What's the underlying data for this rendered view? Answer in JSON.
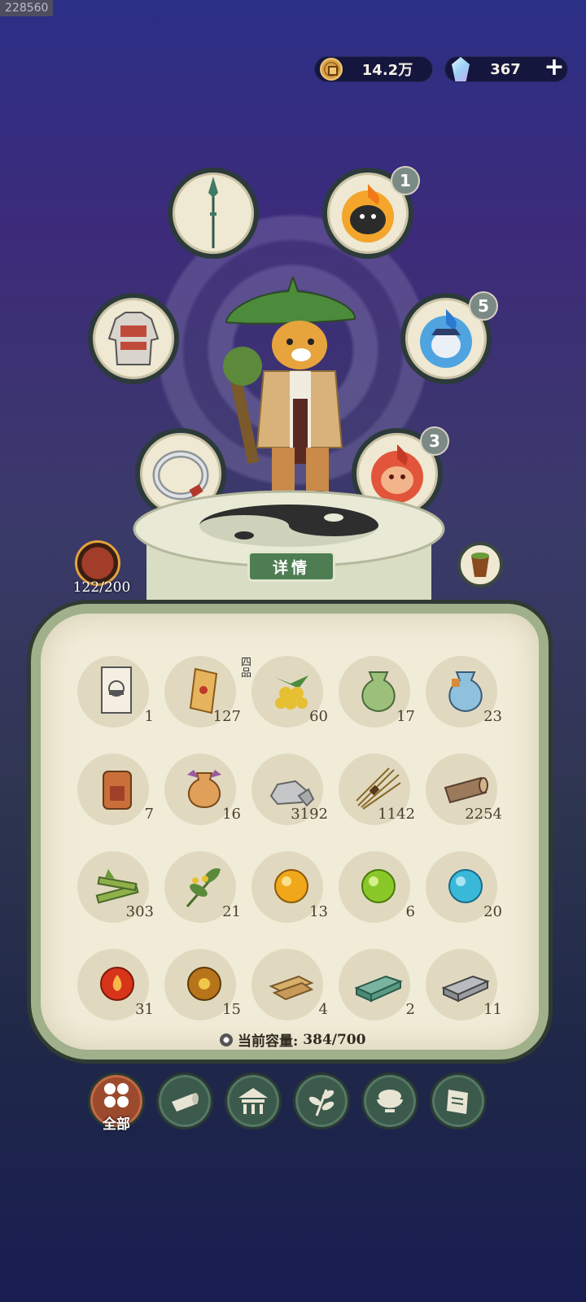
{
  "header": {
    "id_overlay": "228560",
    "coins": "14.2万",
    "gems": "367",
    "add_label": "+"
  },
  "equipment": {
    "slot_badges": [
      "1",
      "5",
      "3"
    ],
    "details_button": "详情",
    "hero_count": "122/200"
  },
  "inventory": {
    "items": [
      {
        "name": "rice-recipe-card-icon",
        "count": "1"
      },
      {
        "name": "scroll-icon",
        "count": "127"
      },
      {
        "name": "yellow-berries-icon",
        "count": "60",
        "grade": "四品"
      },
      {
        "name": "green-pouch-icon",
        "count": "17"
      },
      {
        "name": "blue-pouch-icon",
        "count": "23"
      },
      {
        "name": "token-plaque-icon",
        "count": "7"
      },
      {
        "name": "orange-pouch-icon",
        "count": "16"
      },
      {
        "name": "stone-icon",
        "count": "3192"
      },
      {
        "name": "straw-bundle-icon",
        "count": "1142"
      },
      {
        "name": "log-icon",
        "count": "2254"
      },
      {
        "name": "bamboo-icon",
        "count": "303"
      },
      {
        "name": "herb-sprig-icon",
        "count": "21"
      },
      {
        "name": "yellow-orb-icon",
        "count": "13"
      },
      {
        "name": "green-orb-icon",
        "count": "6"
      },
      {
        "name": "cyan-orb-icon",
        "count": "20"
      },
      {
        "name": "red-fire-orb-icon",
        "count": "31"
      },
      {
        "name": "amber-orb-icon",
        "count": "15"
      },
      {
        "name": "wood-planks-icon",
        "count": "4"
      },
      {
        "name": "jade-ingot-icon",
        "count": "2"
      },
      {
        "name": "iron-ingot-icon",
        "count": "11"
      }
    ],
    "capacity_label": "当前容量:",
    "capacity_value": "384/700"
  },
  "tabs": [
    {
      "name": "all",
      "label": "全部",
      "active": true
    },
    {
      "name": "wood",
      "label": ""
    },
    {
      "name": "building",
      "label": ""
    },
    {
      "name": "herb",
      "label": ""
    },
    {
      "name": "food",
      "label": ""
    },
    {
      "name": "scroll",
      "label": ""
    }
  ]
}
